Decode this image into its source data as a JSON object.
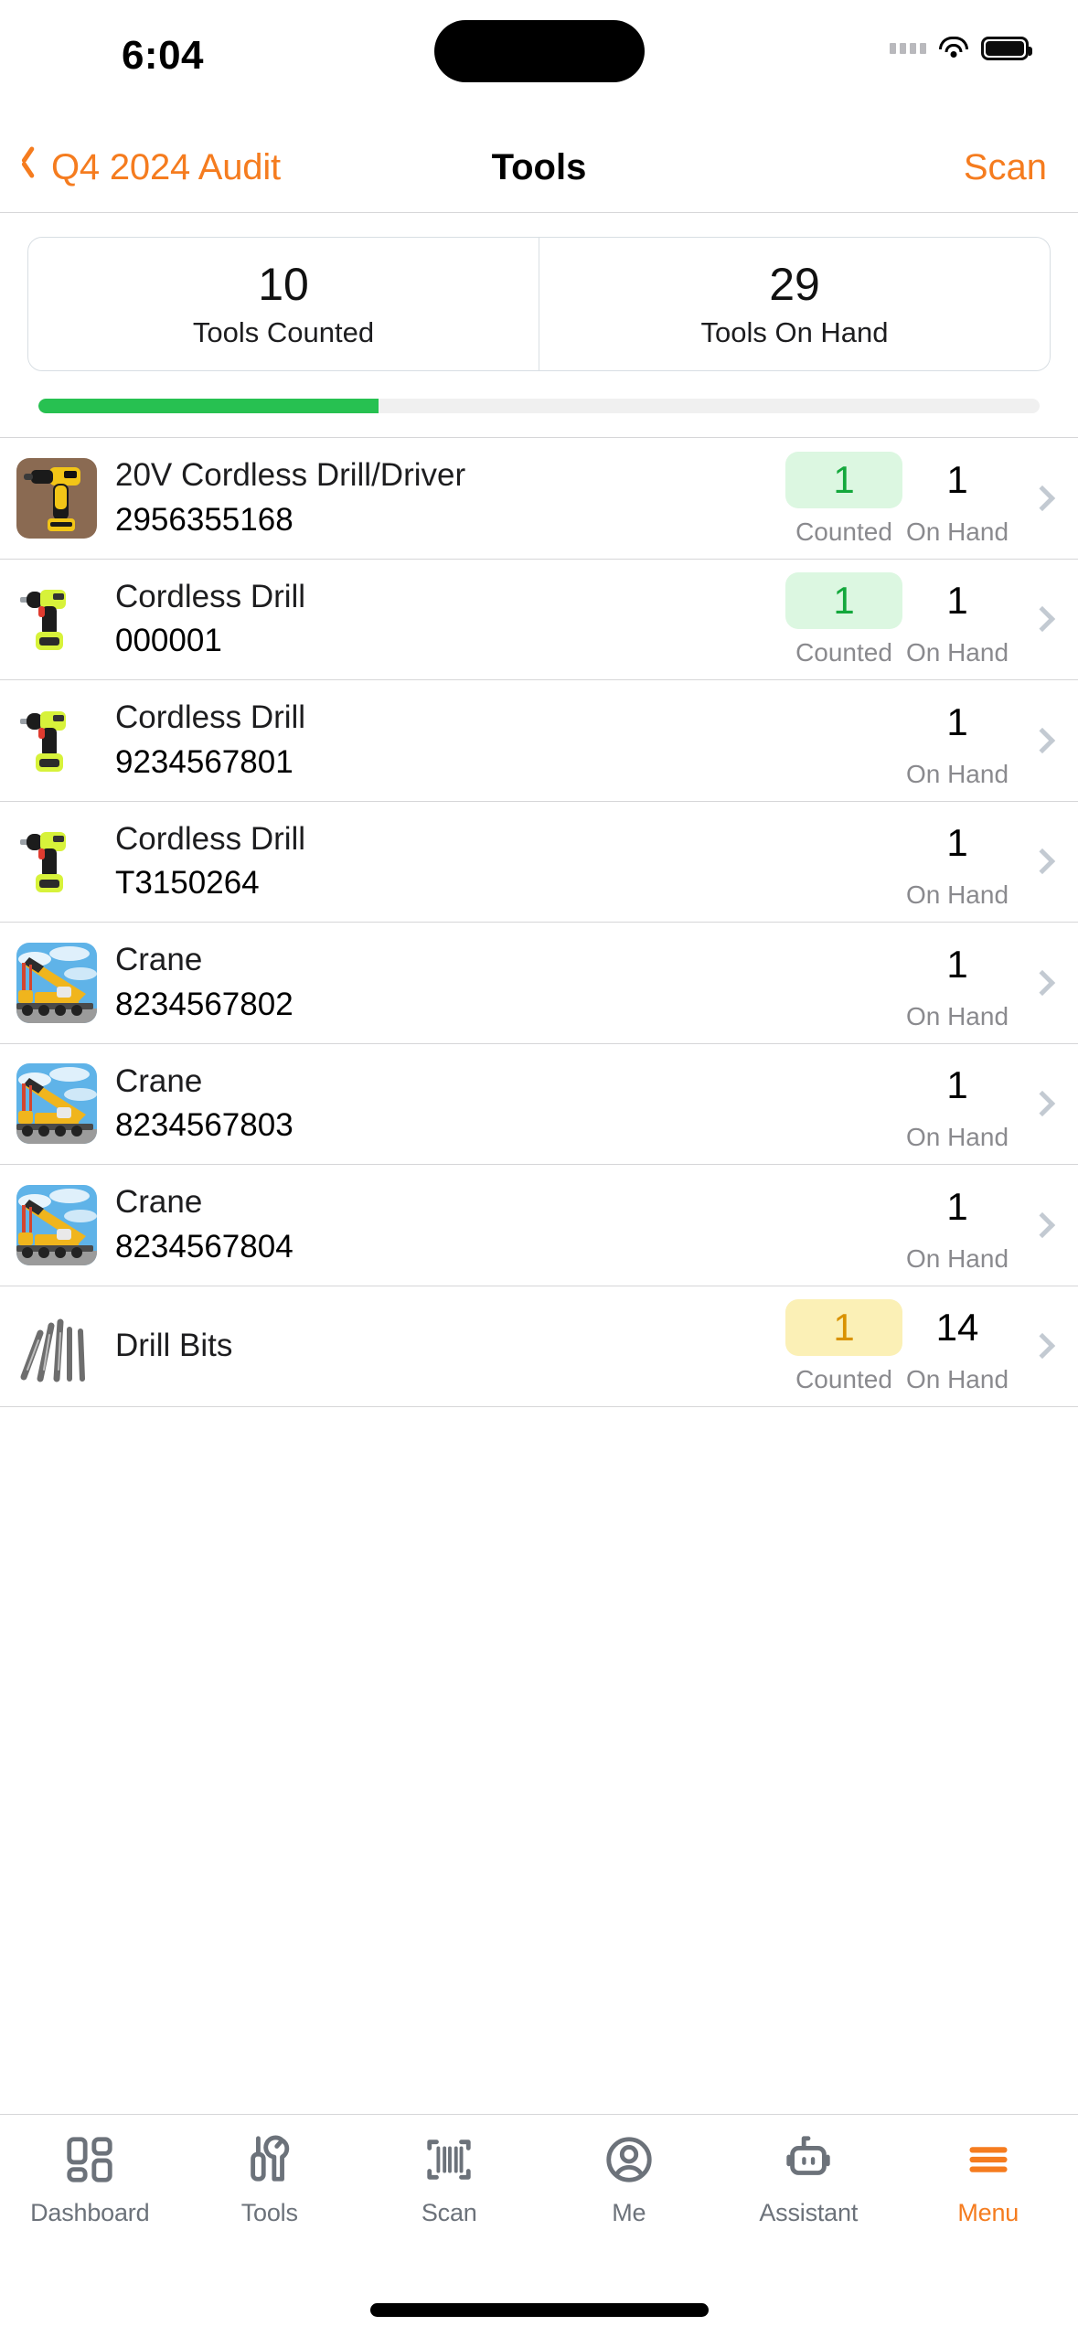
{
  "status_bar": {
    "time": "6:04",
    "cellular_icon": "cellular-dots-icon",
    "wifi_icon": "wifi-icon",
    "battery_icon": "battery-full-icon"
  },
  "nav": {
    "back_icon": "chevron-left-icon",
    "back_label": "Q4 2024 Audit",
    "title": "Tools",
    "action_label": "Scan"
  },
  "summary": {
    "stats": [
      {
        "value": "10",
        "label": "Tools Counted"
      },
      {
        "value": "29",
        "label": "Tools On Hand"
      }
    ],
    "progress_percent": 34,
    "progress_color": "#27C151"
  },
  "colors": {
    "accent": "#F57C1F",
    "counted_green_bg": "#DCF7E1",
    "counted_green_text": "#14A83C",
    "counted_amber_bg": "#FBF0B6",
    "counted_amber_text": "#D99200",
    "separator": "#d6d6d8"
  },
  "list": {
    "counted_caption": "Counted",
    "on_hand_caption": "On Hand",
    "chevron_icon": "chevron-right-icon",
    "rows": [
      {
        "thumb": "dewalt-drill-photo",
        "title": "20V Cordless Drill/Driver",
        "sku": "2956355168",
        "counted": "1",
        "counted_state": "green",
        "on_hand": "1"
      },
      {
        "thumb": "cordless-drill-photo",
        "title": "Cordless Drill",
        "sku": "000001",
        "counted": "1",
        "counted_state": "green",
        "on_hand": "1"
      },
      {
        "thumb": "cordless-drill-photo",
        "title": "Cordless Drill",
        "sku": "9234567801",
        "counted": "",
        "counted_state": "none",
        "on_hand": "1"
      },
      {
        "thumb": "cordless-drill-photo",
        "title": "Cordless Drill",
        "sku": "T3150264",
        "counted": "",
        "counted_state": "none",
        "on_hand": "1"
      },
      {
        "thumb": "crane-photo",
        "title": "Crane",
        "sku": "8234567802",
        "counted": "",
        "counted_state": "none",
        "on_hand": "1"
      },
      {
        "thumb": "crane-photo",
        "title": "Crane",
        "sku": "8234567803",
        "counted": "",
        "counted_state": "none",
        "on_hand": "1"
      },
      {
        "thumb": "crane-photo",
        "title": "Crane",
        "sku": "8234567804",
        "counted": "",
        "counted_state": "none",
        "on_hand": "1"
      },
      {
        "thumb": "drill-bits-photo",
        "title": "Drill Bits",
        "sku": "",
        "counted": "1",
        "counted_state": "amber",
        "on_hand": "14"
      }
    ]
  },
  "tab_bar": {
    "items": [
      {
        "icon": "dashboard-grid-icon",
        "label": "Dashboard",
        "active": false
      },
      {
        "icon": "tools-icon",
        "label": "Tools",
        "active": false
      },
      {
        "icon": "barcode-scan-icon",
        "label": "Scan",
        "active": false
      },
      {
        "icon": "person-circle-icon",
        "label": "Me",
        "active": false
      },
      {
        "icon": "robot-icon",
        "label": "Assistant",
        "active": false
      },
      {
        "icon": "hamburger-menu-icon",
        "label": "Menu",
        "active": true
      }
    ]
  }
}
